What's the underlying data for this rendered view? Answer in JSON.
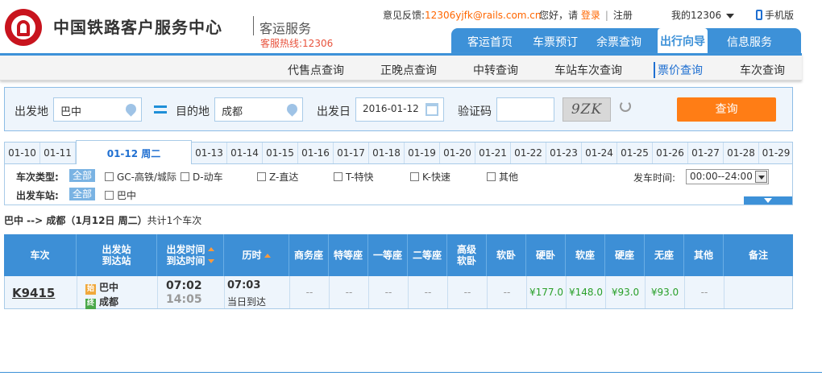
{
  "header": {
    "brand": "中国铁路客户服务中心",
    "subtitle": "客运服务",
    "hotline": "客服热线:12306",
    "feedback_label": "意见反馈:",
    "feedback_email": "12306yjfk@rails.com.cn",
    "greeting": "您好，请",
    "login": "登录",
    "register": "注册",
    "my12306": "我的12306",
    "mobile": "手机版"
  },
  "main_nav": [
    "客运首页",
    "车票预订",
    "余票查询",
    "出行向导",
    "信息服务"
  ],
  "sub_nav": [
    "代售点查询",
    "正晚点查询",
    "中转查询",
    "车站车次查询",
    "票价查询",
    "车次查询"
  ],
  "search": {
    "from_label": "出发地",
    "from_value": "巴中",
    "to_label": "目的地",
    "to_value": "成都",
    "date_label": "出发日",
    "date_value": "2016-01-12",
    "captcha_label": "验证码",
    "captcha_value": "",
    "captcha_text": "9ZK",
    "query_button": "查询"
  },
  "date_tabs": [
    "01-10",
    "01-11",
    "01-12 周二",
    "01-13",
    "01-14",
    "01-15",
    "01-16",
    "01-17",
    "01-18",
    "01-19",
    "01-20",
    "01-21",
    "01-22",
    "01-23",
    "01-24",
    "01-25",
    "01-26",
    "01-27",
    "01-28",
    "01-29"
  ],
  "filters": {
    "train_type_label": "车次类型:",
    "all_badge": "全部",
    "types": [
      "GC-高铁/城际",
      "D-动车",
      "Z-直达",
      "T-特快",
      "K-快速",
      "其他"
    ],
    "depart_time_label": "发车时间:",
    "depart_time_value": "00:00--24:00",
    "station_label": "出发车站:",
    "stations": [
      "巴中"
    ]
  },
  "route_summary": {
    "route": "巴中 --> 成都（1月12日  周二）",
    "count": "共计1个车次"
  },
  "table": {
    "headers": [
      "车次",
      "出发站",
      "到达站",
      "出发时间",
      "到达时间",
      "历时",
      "商务座",
      "特等座",
      "一等座",
      "二等座",
      "高级",
      "软卧",
      "软卧",
      "硬卧",
      "软座",
      "硬座",
      "无座",
      "其他",
      "备注"
    ],
    "row": {
      "train_no": "K9415",
      "from_icon": "始",
      "from_station": "巴中",
      "to_icon": "终",
      "to_station": "成都",
      "depart": "07:02",
      "arrive": "14:05",
      "duration": "07:03",
      "arrival_day": "当日到达",
      "seats": [
        "--",
        "--",
        "--",
        "--",
        "--",
        "--",
        "¥177.0",
        "¥148.0",
        "¥93.0",
        "¥93.0",
        "--"
      ],
      "remark": ""
    }
  },
  "colors": {
    "primary_blue": "#3d91d8",
    "accent_orange": "#ff7d15",
    "price_green": "#2aa02a",
    "brand_red": "#c8141e"
  }
}
